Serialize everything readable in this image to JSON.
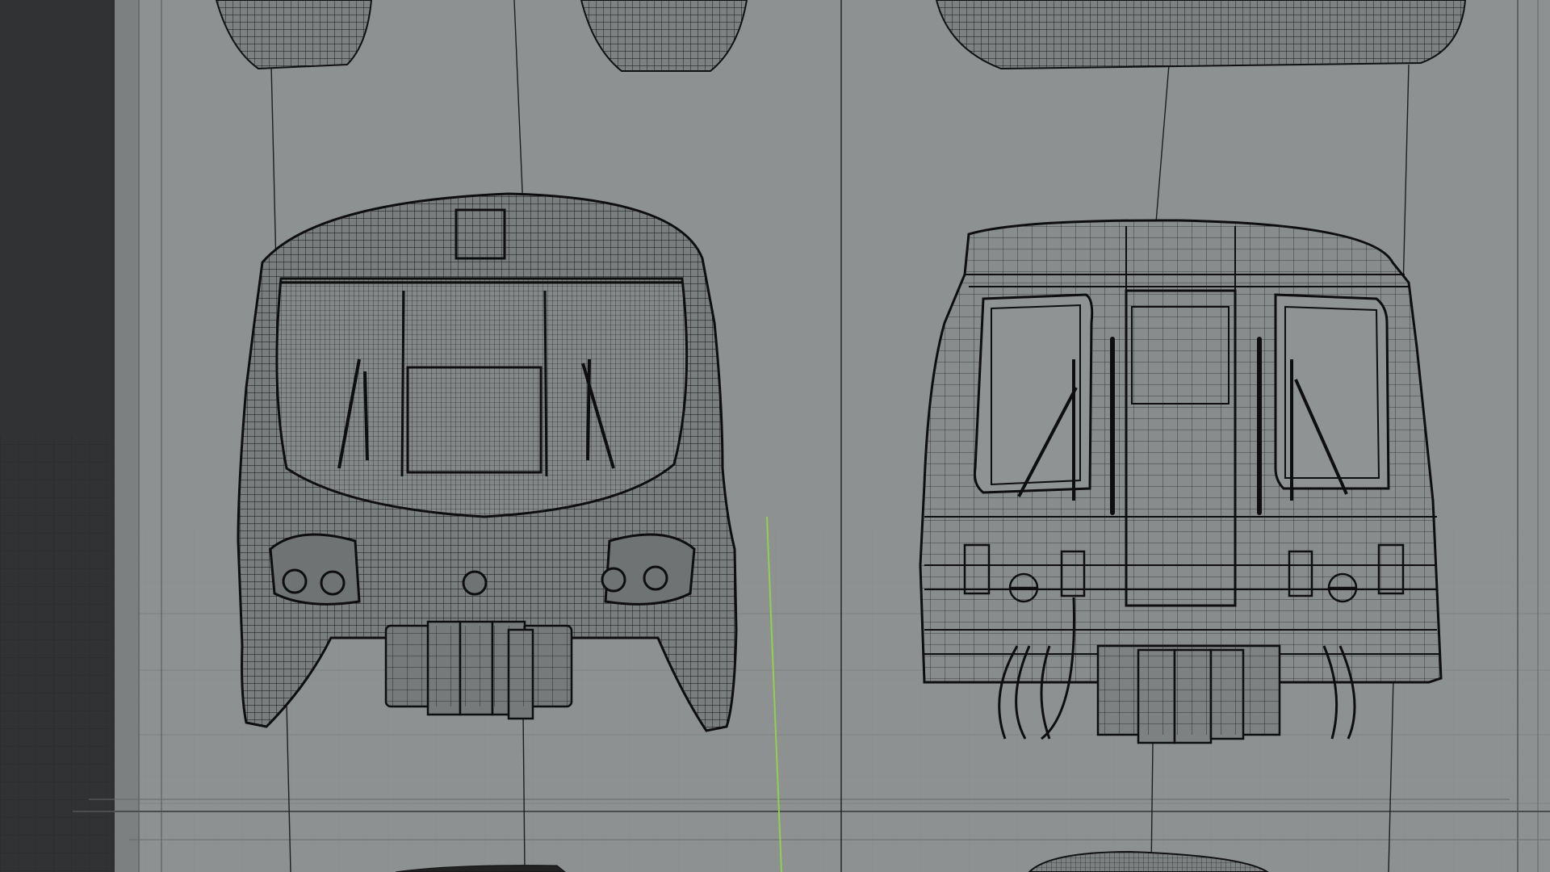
{
  "viewport": {
    "kind": "3D modeling viewport (wireframe mode)",
    "background_color": "#8c9091",
    "floor_grid_color": "#3a3c3d",
    "wire_color": "#111111",
    "axis_color": "#8fd14f"
  },
  "objects": [
    {
      "name": "train-front-curved",
      "style": "dense wireframe"
    },
    {
      "name": "train-front-boxy",
      "style": "wireframe"
    },
    {
      "name": "train-part-top-left"
    },
    {
      "name": "train-part-top-right"
    },
    {
      "name": "train-part-bottom"
    }
  ],
  "icons": [
    "wireframe-mesh",
    "green-y-axis-line",
    "ground-grid"
  ]
}
